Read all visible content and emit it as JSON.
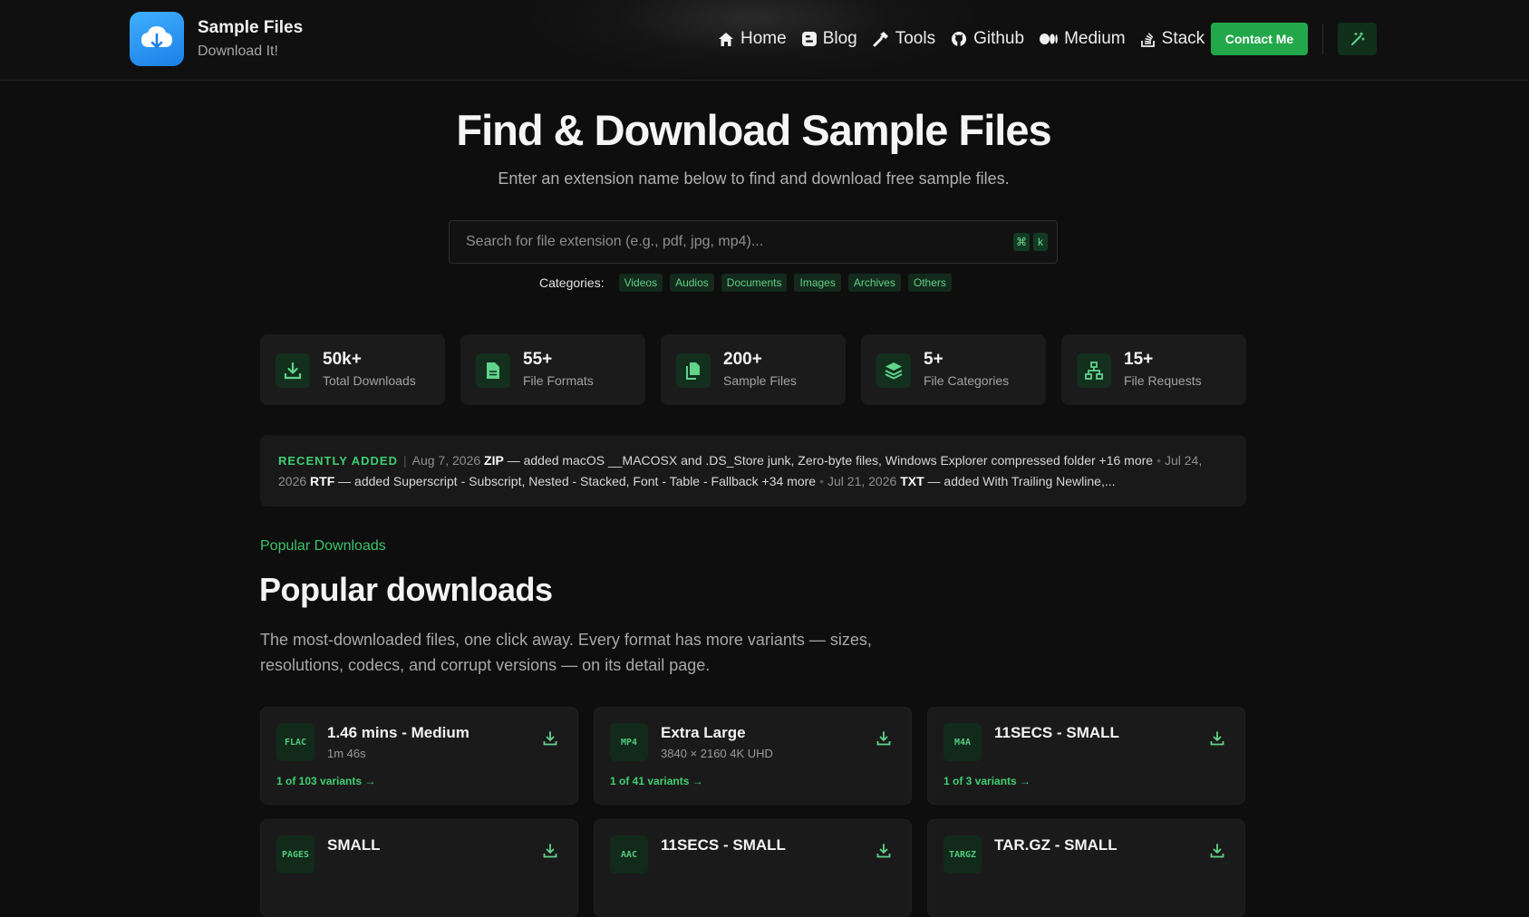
{
  "brand": {
    "title": "Sample Files",
    "subtitle": "Download It!"
  },
  "nav": {
    "items": [
      {
        "label": "Home",
        "icon": "home-icon"
      },
      {
        "label": "Blog",
        "icon": "blogger-icon"
      },
      {
        "label": "Tools",
        "icon": "hammer-icon"
      },
      {
        "label": "Github",
        "icon": "github-icon"
      },
      {
        "label": "Medium",
        "icon": "medium-icon"
      },
      {
        "label": "Stack",
        "icon": "stackoverflow-icon"
      }
    ],
    "contact_label": "Contact Me",
    "theme_icon": "magic-wand-icon"
  },
  "hero": {
    "title": "Find & Download Sample Files",
    "subtitle": "Enter an extension name below to find and download free sample files.",
    "search_placeholder": "Search for file extension (e.g., pdf, jpg, mp4)...",
    "shortcut_keys": [
      "⌘",
      "k"
    ]
  },
  "categories": {
    "label": "Categories:",
    "items": [
      "Videos",
      "Audios",
      "Documents",
      "Images",
      "Archives",
      "Others"
    ]
  },
  "stats": [
    {
      "value": "50k+",
      "label": "Total Downloads",
      "icon": "download-icon"
    },
    {
      "value": "55+",
      "label": "File Formats",
      "icon": "file-icon"
    },
    {
      "value": "200+",
      "label": "Sample Files",
      "icon": "copy-files-icon"
    },
    {
      "value": "5+",
      "label": "File Categories",
      "icon": "layers-icon"
    },
    {
      "value": "15+",
      "label": "File Requests",
      "icon": "sitemap-icon"
    }
  ],
  "recent": {
    "tag": "RECENTLY ADDED",
    "entries": [
      {
        "date": "Aug 7, 2026",
        "format": "ZIP",
        "text": "— added macOS __MACOSX and .DS_Store junk, Zero-byte files, Windows Explorer compressed folder +16 more"
      },
      {
        "date": "Jul 24, 2026",
        "format": "RTF",
        "text": "— added Superscript - Subscript, Nested - Stacked, Font - Table - Fallback +34 more"
      },
      {
        "date": "Jul 21, 2026",
        "format": "TXT",
        "text": "— added With Trailing Newline,..."
      }
    ]
  },
  "popular": {
    "eyebrow": "Popular Downloads",
    "title": "Popular downloads",
    "description": "The most-downloaded files, one click away. Every format has more variants — sizes, resolutions, codecs, and corrupt versions — on its detail page.",
    "cards": [
      {
        "ext": "FLAC",
        "title": "1.46 mins - Medium",
        "sub": "1m 46s",
        "variants": "1 of 103 variants →"
      },
      {
        "ext": "MP4",
        "title": "Extra Large",
        "sub": "3840 × 2160 4K UHD",
        "variants": "1 of 41 variants →"
      },
      {
        "ext": "M4A",
        "title": "11SECS - SMALL",
        "sub": "",
        "variants": "1 of 3 variants →"
      },
      {
        "ext": "PAGES",
        "title": "SMALL",
        "sub": "",
        "variants": ""
      },
      {
        "ext": "AAC",
        "title": "11SECS - SMALL",
        "sub": "",
        "variants": ""
      },
      {
        "ext": "TARGZ",
        "title": "TAR.GZ - SMALL",
        "sub": "",
        "variants": ""
      }
    ]
  },
  "colors": {
    "accent": "#22a84a",
    "accent_text": "#3fce72",
    "background": "#0e0e0e",
    "card": "#1a1a1a"
  }
}
